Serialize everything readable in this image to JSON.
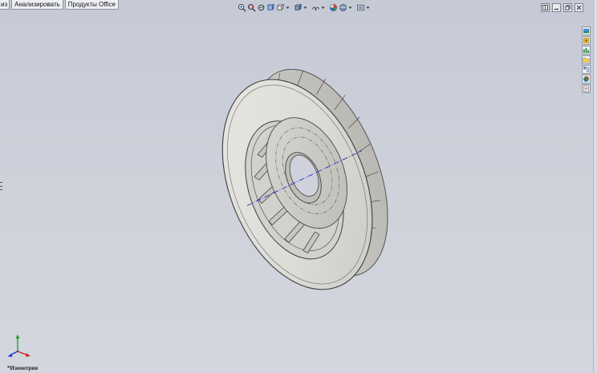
{
  "tabs": [
    "из",
    "Анализировать",
    "Продукты Office"
  ],
  "hud_toolbar": [
    "zoom-to-fit-icon",
    "zoom-to-area-icon",
    "previous-view-icon",
    "section-view-icon",
    "view-orientation-icon",
    "display-style-icon",
    "hide-show-items-icon",
    "edit-appearance-icon",
    "apply-scene-icon",
    "view-settings-icon"
  ],
  "task_pane": [
    "solidworks-resources-icon",
    "design-library-icon",
    "file-explorer-icon",
    "view-palette-icon",
    "appearances-icon",
    "custom-properties-icon"
  ],
  "view_label": "*Изометрия",
  "colors": {
    "background": "#c9cdd7",
    "model_face": "#dddcd6",
    "model_edge": "#4a4a4a",
    "axis_line": "#2233cc",
    "triad_x": "#d01818",
    "triad_y": "#18a018",
    "triad_z": "#1830d0"
  }
}
